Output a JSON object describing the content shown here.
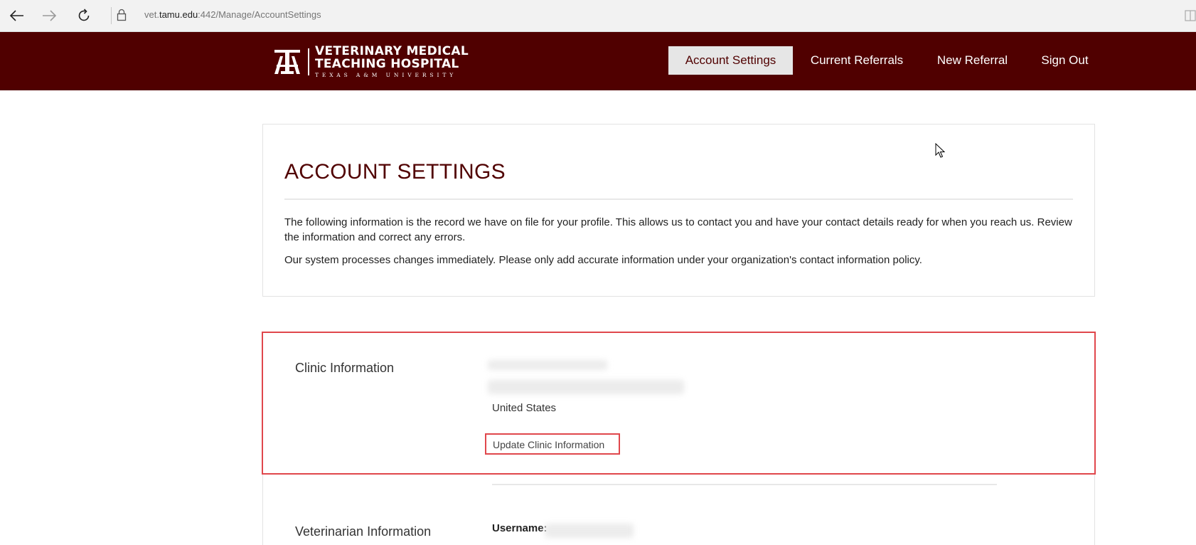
{
  "browser": {
    "url_prefix": "vet.",
    "url_host": "tamu.edu",
    "url_path": ":442/Manage/AccountSettings",
    "icons": [
      "back-arrow-icon",
      "forward-arrow-icon",
      "refresh-icon",
      "lock-icon",
      "reading-view-icon"
    ]
  },
  "header": {
    "logo": {
      "line1": "VETERINARY MEDICAL",
      "line2": "TEACHING HOSPITAL",
      "line3": "TEXAS A&M UNIVERSITY"
    },
    "nav": [
      {
        "label": "Account Settings",
        "active": true
      },
      {
        "label": "Current Referrals",
        "active": false
      },
      {
        "label": "New Referral",
        "active": false
      },
      {
        "label": "Sign Out",
        "active": false
      }
    ]
  },
  "intro": {
    "title": "ACCOUNT SETTINGS",
    "paragraph1": "The following information is the record we have on file for your profile. This allows us to contact you and have your contact details ready for when you reach us. Review the information and correct any errors.",
    "paragraph2": "Our system processes changes immediately. Please only add accurate information under your organization's contact information policy."
  },
  "clinic": {
    "label": "Clinic Information",
    "country": "United States",
    "update_button": "Update Clinic Information"
  },
  "veterinarian": {
    "label": "Veterinarian Information",
    "username_label": "Username:"
  },
  "colors": {
    "brand_maroon": "#500000",
    "highlight_red": "#e0474c",
    "active_tab_bg": "#e6e6e6"
  }
}
